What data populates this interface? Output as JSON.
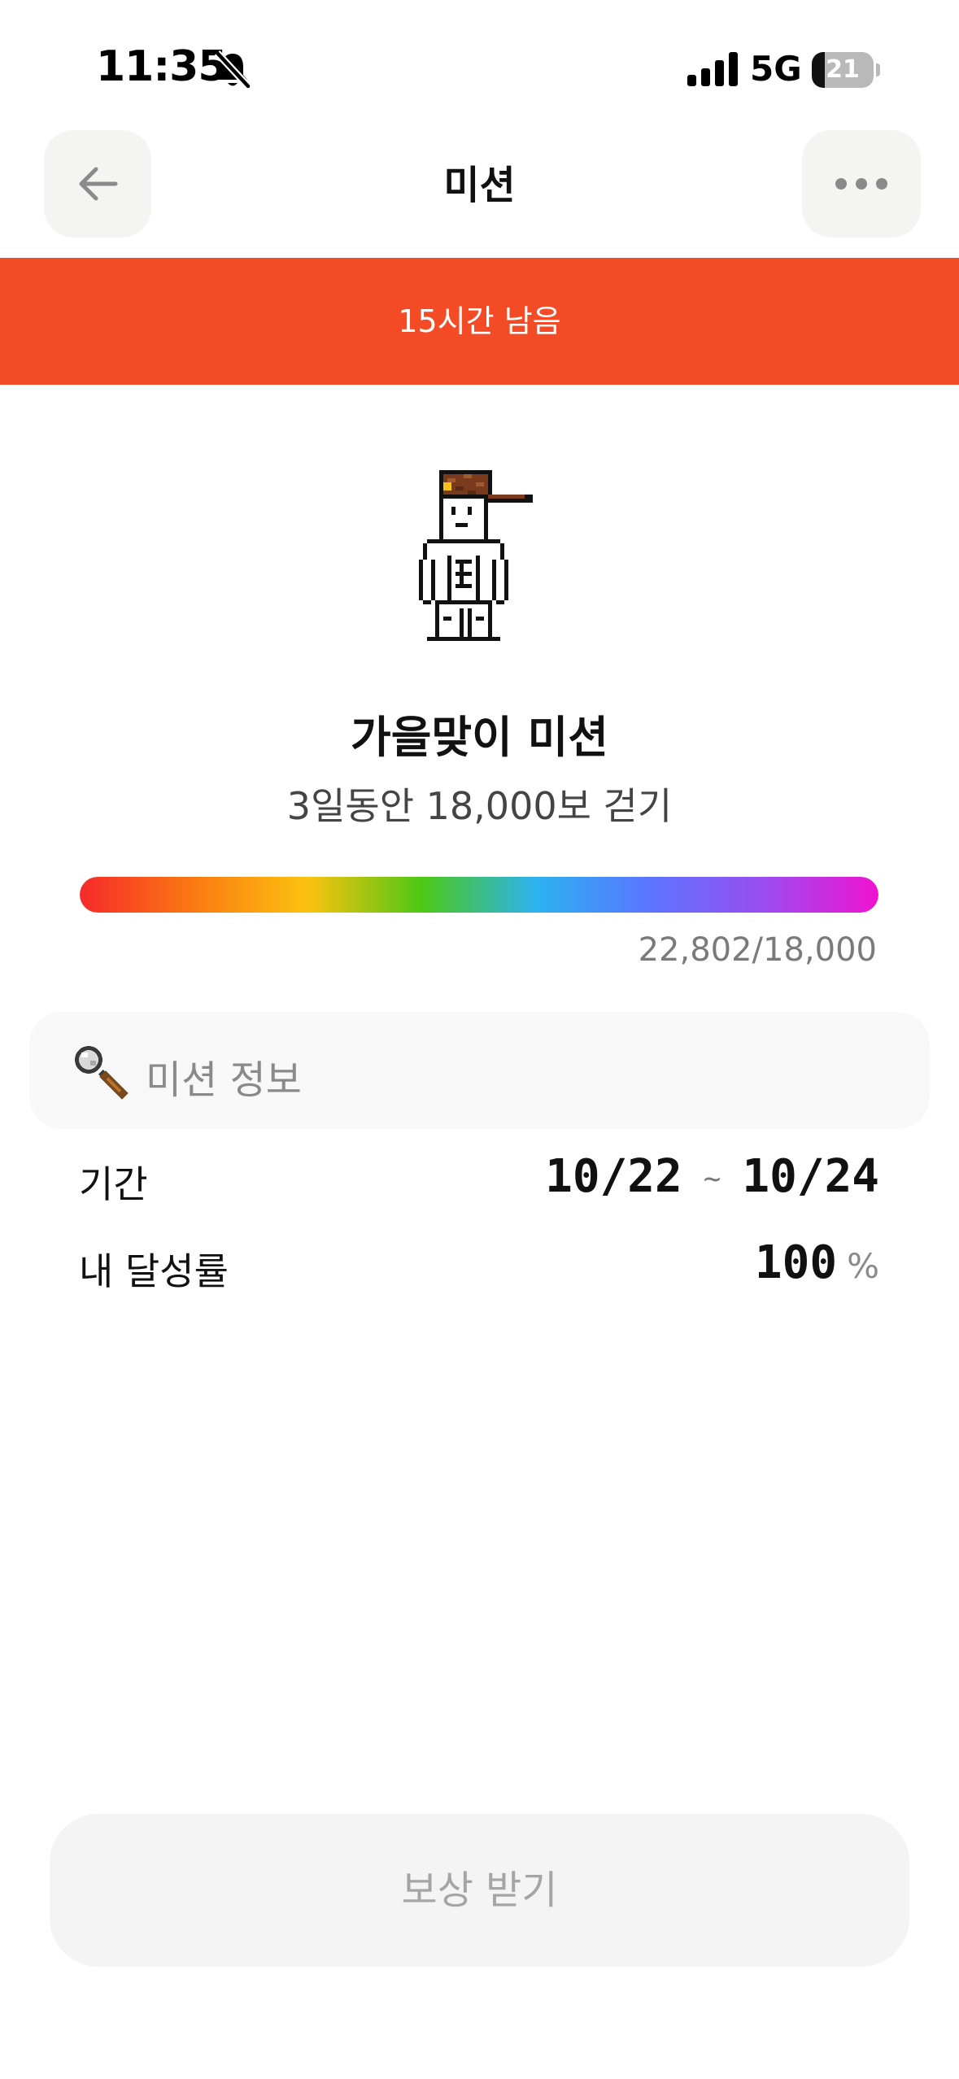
{
  "status_bar": {
    "time": "11:35",
    "network": "5G",
    "battery": "21",
    "battery_level_percent": 21,
    "icons": [
      "bell-muted-icon",
      "signal-icon",
      "battery-icon"
    ]
  },
  "nav": {
    "title": "미션",
    "back_icon": "arrow-left-icon",
    "more_icon": "more-horizontal-icon"
  },
  "banner": {
    "text": "15시간 남음",
    "color": "#f24b25"
  },
  "mission": {
    "title": "가을맞이 미션",
    "description": "3일동안 18,000보 걷기",
    "progress_text": "22,802/18,000",
    "progress_fraction": 1.0,
    "progress_gradient": [
      "#f52a2a",
      "#fb7a12",
      "#fcc210",
      "#4cc814",
      "#2cb2f0",
      "#5b75ff",
      "#9c4cf0",
      "#f012d0"
    ]
  },
  "info": {
    "header": "미션 정보",
    "header_icon": "magnifier-icon",
    "period_label": "기간",
    "period_start": "10/22",
    "period_sep": "~",
    "period_end": "10/24",
    "rate_label": "내 달성률",
    "rate_value": "100",
    "rate_unit": "%"
  },
  "reward_button": {
    "label": "보상 받기"
  }
}
